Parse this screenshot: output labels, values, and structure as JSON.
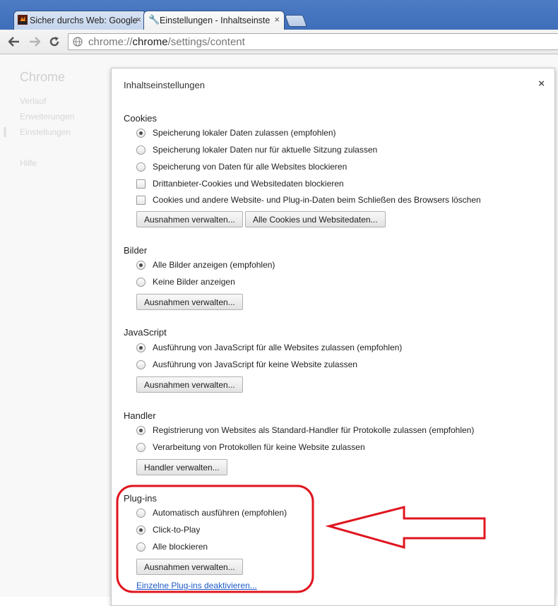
{
  "tabs": [
    {
      "title": "Sicher durchs Web: Google",
      "close": "×"
    },
    {
      "title": "Einstellungen - Inhaltseinste",
      "close": "×"
    }
  ],
  "omnibox": {
    "scheme": "chrome://",
    "host": "chrome",
    "path": "/settings/content"
  },
  "sidebar": {
    "title": "Chrome",
    "items": [
      "Verlauf",
      "Erweiterungen",
      "Einstellungen",
      "Hilfe"
    ]
  },
  "dialog": {
    "title": "Inhaltseinstellungen",
    "close": "×",
    "cookies": {
      "title": "Cookies",
      "options": [
        "Speicherung lokaler Daten zulassen (empfohlen)",
        "Speicherung lokaler Daten nur für aktuelle Sitzung zulassen",
        "Speicherung von Daten für alle Websites blockieren"
      ],
      "checkboxes": [
        "Drittanbieter-Cookies und Websitedaten blockieren",
        "Cookies und andere Website- und Plug-in-Daten beim Schließen des Browsers löschen"
      ],
      "btn_exceptions": "Ausnahmen verwalten...",
      "btn_all_cookies": "Alle Cookies und Websitedaten..."
    },
    "images": {
      "title": "Bilder",
      "options": [
        "Alle Bilder anzeigen (empfohlen)",
        "Keine Bilder anzeigen"
      ],
      "btn_exceptions": "Ausnahmen verwalten..."
    },
    "javascript": {
      "title": "JavaScript",
      "options": [
        "Ausführung von JavaScript für alle Websites zulassen (empfohlen)",
        "Ausführung von JavaScript für keine Website zulassen"
      ],
      "btn_exceptions": "Ausnahmen verwalten..."
    },
    "handler": {
      "title": "Handler",
      "options": [
        "Registrierung von Websites als Standard-Handler für Protokolle zulassen (empfohlen)",
        "Verarbeitung von Protokollen für keine Website zulassen"
      ],
      "btn_manage": "Handler verwalten..."
    },
    "plugins": {
      "title": "Plug-ins",
      "options": [
        "Automatisch ausführen (empfohlen)",
        "Click-to-Play",
        "Alle blockieren"
      ],
      "btn_exceptions": "Ausnahmen verwalten...",
      "link_disable": "Einzelne Plug-ins deaktivieren..."
    }
  },
  "colors": {
    "annotation": "#e0151f",
    "link": "#1e5bc6",
    "tabstrip": "#4470bb"
  }
}
